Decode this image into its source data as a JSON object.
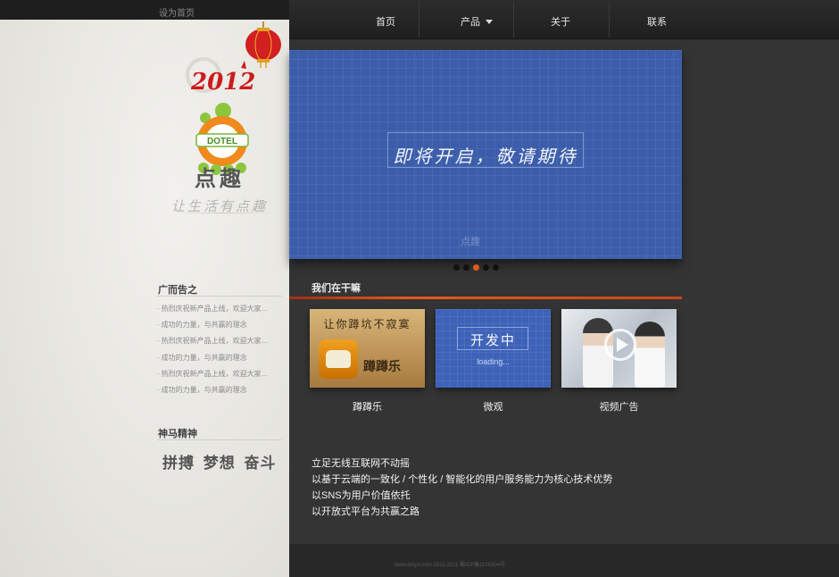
{
  "top_link": "设为首页",
  "brand": {
    "year_mark": "2012",
    "logo_text": "DOTEL",
    "name": "点趣",
    "slogan": "让生活有点趣"
  },
  "nav": {
    "items": [
      {
        "label": "首页"
      },
      {
        "label": "产品"
      },
      {
        "label": "关于"
      },
      {
        "label": "联系"
      }
    ]
  },
  "ads": {
    "title": "广而告之",
    "items": [
      "热烈庆祝新产品上线，欢迎大家...",
      "成功的力量，与共赢的理念",
      "热烈庆祝新产品上线，欢迎大家...",
      "成功的力量，与共赢的理念",
      "热烈庆祝新产品上线，欢迎大家...",
      "成功的力量，与共赢的理念"
    ]
  },
  "spirit": {
    "title": "神马精神",
    "text": "拼搏 梦想 奋斗"
  },
  "banner": {
    "text": "即将开启，敬请期待",
    "watermark": "点趣",
    "dots_count": 5,
    "active_dot": 3
  },
  "works": {
    "title": "我们在干嘛",
    "cards": [
      {
        "label": "蹲蹲乐",
        "thumb_heading": "让你蹲坑不寂寞",
        "thumb_name": "蹲蹲乐"
      },
      {
        "label": "微观",
        "thumb_heading": "开发中",
        "thumb_sub": "loading..."
      },
      {
        "label": "视频广告"
      }
    ]
  },
  "mission": [
    "立足无线互联网不动摇",
    "以基于云端的一致化 / 个性化 / 智能化的用户服务能力为核心技术优势",
    "以SNS为用户价值依托",
    "以开放式平台为共赢之路"
  ],
  "footer": {
    "text": "www.dotyu.com 2011-2011 蜀ICP备1100304号"
  },
  "colors": {
    "accent": "#e05a1a",
    "banner_blue": "#3c5daa",
    "dark_bg": "#343434"
  }
}
